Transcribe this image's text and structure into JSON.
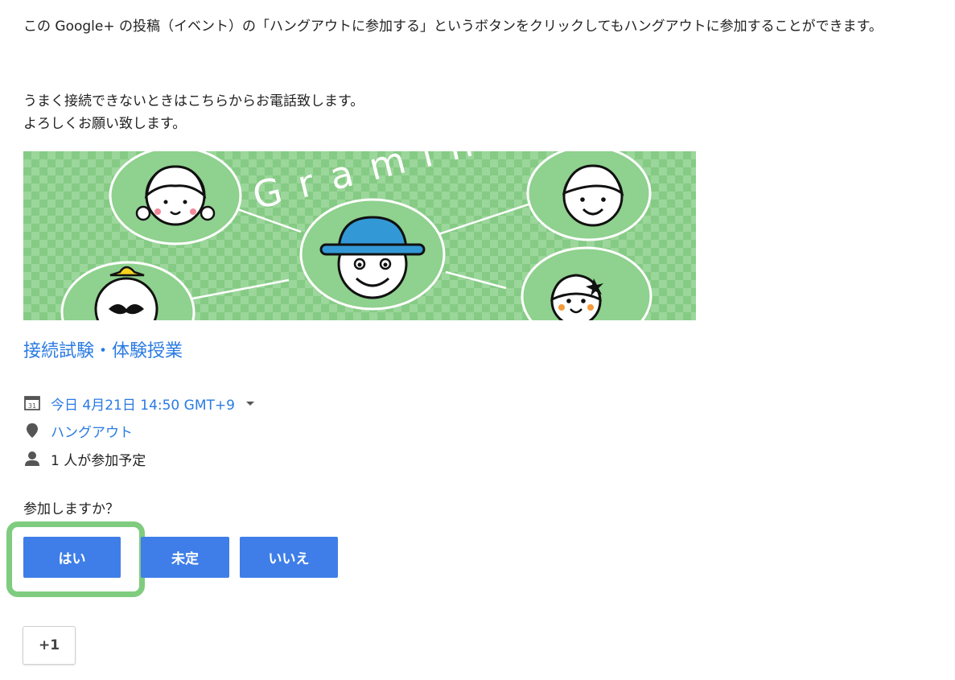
{
  "message": {
    "paragraph1": "この Google+ の投稿（イベント）の「ハングアウトに参加する」というボタンをクリックしてもハングアウトに参加することができます。",
    "line2": "うまく接続できないときはこちらからお電話致します。",
    "line3": "よろしくお願い致します。"
  },
  "banner": {
    "logo_text": "Gramin",
    "background_color": "#8fd18e",
    "accent_color": "#3399d6"
  },
  "event": {
    "title": "接続試験・体験授業",
    "datetime": "今日 4月21日 14:50 GMT+9",
    "location": "ハングアウト",
    "guests": "1 人が参加予定",
    "date_icon": "calendar-icon",
    "location_icon": "map-pin-icon",
    "guests_icon": "person-icon"
  },
  "rsvp": {
    "question": "参加しますか？",
    "yes_label": "はい",
    "maybe_label": "未定",
    "no_label": "いいえ",
    "button_color": "#3f7ee8",
    "highlight_color": "#7fcc7f"
  },
  "plusone": {
    "label": "+1"
  }
}
